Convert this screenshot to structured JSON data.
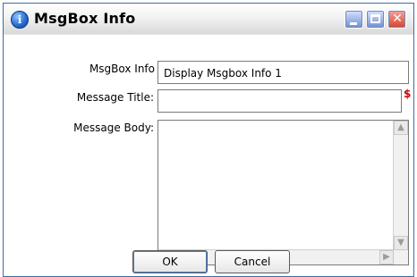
{
  "window": {
    "title": "MsgBox Info",
    "icon": "info-icon",
    "controls": {
      "minimize": "minimize-icon",
      "maximize": "maximize-icon",
      "close": "close-icon"
    }
  },
  "form": {
    "msgbox_info_label": "MsgBox Info",
    "msgbox_info_value": "Display Msgbox Info 1",
    "message_title_label": "Message Title:",
    "message_title_value": "",
    "required_marker": "$",
    "message_body_label": "Message Body:",
    "message_body_value": ""
  },
  "buttons": {
    "ok": "OK",
    "cancel": "Cancel"
  },
  "colors": {
    "required_marker": "#cc0000"
  }
}
